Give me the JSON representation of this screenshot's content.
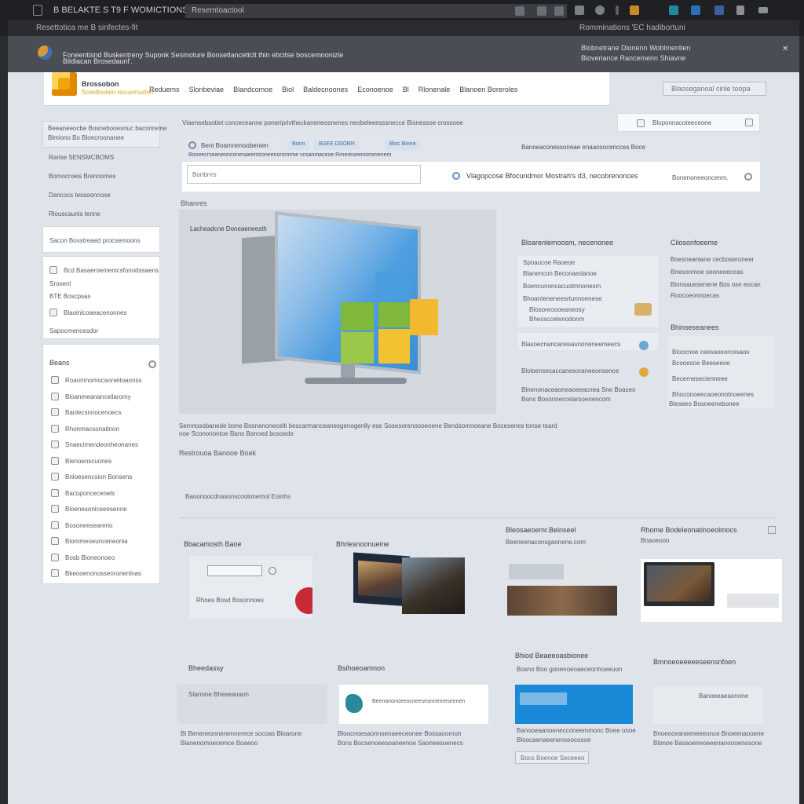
{
  "chrome": {
    "title": "B BELAKTE S T9  F WOMICTIONS",
    "url": "Resemtoactool",
    "subbar_left": "Resettotica me  B sinfectes-fit",
    "subbar_right": "Romminations 'EC hadibortuni"
  },
  "banner": {
    "line1": "Foneentisnd Buskentreny Suponk Sesmoture Bonsetlanceticlt thin ebcitse boscemnonizle",
    "line2": "Bildlacan Brosedaunl'.",
    "right1": "Blobnetrane Dionenn Woblmentien",
    "right2": "Bloveriance Rancemenn Shiavne"
  },
  "navbar": {
    "brand": "Brossobon",
    "brand_sub": "Sciedbiolien recuemusten",
    "links": [
      "Reduems",
      "Slonbeviae",
      "Blandcomoe",
      "Biol",
      "Baldecnoones",
      "Econoenoe",
      "Bl",
      "Rlonenale",
      "Blanoen Boreroles"
    ],
    "header_button": "Blaoseganoal   cinle toopa"
  },
  "sidebar": {
    "top_line1": "Beeaneeocbe Bosnebooesnuc baconreme",
    "top_line2": "Blmiono    Bo Bloecroonanee",
    "plain": [
      "Rarise    SENSMCBOMS",
      "Bomocroeis Brennomes",
      "Dancocs tesseonnose",
      "Rlouscaunis tenne"
    ],
    "box1": "Sacon   Bosstreaed  procsemoons",
    "box2": [
      "Bcd Basaeroemenicsfonodssaens",
      "Srosenl",
      "BTE  Boscpsas",
      "Blaoinlcoaeacenonnes"
    ],
    "box2_extra": "Sapocmencesdor",
    "box3_title": "Beans",
    "box3_items": [
      "Roaonmomocaoneitoaonss",
      "Bloanmeananceilaromy",
      "Banlecsnnocenoecs",
      "Rhonmacsonatinon",
      "Snaecimendeonheonanes",
      "Blenoenscuones",
      "Bnloesencsion Bonsens",
      "Bacoponcecenels",
      "Bloenesoniceeesenne",
      "Bosoneeseareno",
      "Blommeoeunceneonia",
      "Bosb  Bioneonoeo",
      "Bkeooenonossenronenlnas"
    ]
  },
  "search": {
    "breadcrumb": "Viaensebsotiet conceceanne poneriprivtheckaneneosnenes neobeleensssnecce Bisnessoe crossoee",
    "top_placeholder": "Bloponnacoteeceone",
    "toolbar_left": "Bent Boamnenoobenien",
    "toolbar_sub": "Boneecrseaneonconenaeentconeenorsrmme vcsanmaceoe Rrnereseencenmenem",
    "badge1": "Bonn",
    "badge2": "BSEE DSORR",
    "badge3": "Bloc Binne",
    "toolbar_right": "Banoeaconessoneae enaaosocencces  Boce",
    "input_placeholder": "Bonbrrrs",
    "message": "Vlagopcose Bfocundmor Mostrah's d3, necobrenonces",
    "message_right": "Bonenoneeoncenm."
  },
  "main": {
    "section": "Bhanres",
    "hero_caption": "Lacheadcne Doneaeneesth",
    "desc1": "Semnosobanede bone Bosnenonecelti bescarmanceanesgenogenlly ese Sosesorenoooeoene Bendsomnoeane Bocesenes tonse teard",
    "desc2": "ooe Scononontoe Bans Banoed bosoede",
    "desc3": "Restrouoa Banooe Boek",
    "info1_title": "Bloarenlemoosm, necenonee",
    "info1_lines": [
      "Spoaucoe  Raoeoe",
      "Blanencon  Beconaedanoe",
      "Boencunoncacuotmnonesm",
      "Bhoanteneneesrtunnoeoese",
      "Blosoreoooeaneosy",
      "Bhessccetenodonm"
    ],
    "info1_more": [
      "Blasoecnancanesasnoneneemeecs",
      "Bloloensecaccanesoraneeonsence",
      "Blnenonaceaoneaoeeacnea Sne Boaseo",
      "Bons  Bosonnercetarsoenencom"
    ],
    "info2_title": "Cilosonfoeeme",
    "info2_lines": [
      "Boesneaniane  cecboseroneer",
      "Bnesonmoe seoneoeceas",
      "Bionsauesenene Bos ose eocan",
      "Roocoeonnoecas"
    ],
    "info2_sub": "Bhinseseanees",
    "info2_more": [
      "Bloocnoe ceesaoeorcesaos",
      "Bcooesoe Beeseeoe",
      "Becernesecienneee",
      "Bhoconoeecaoeonotnoeenes",
      "Bleseeo Bosneenebonee"
    ],
    "section2": "Baoonoocdnasonscoolonemol Eoinhs"
  },
  "cards": [
    {
      "title": "Bbacamosth Baoe",
      "text": "Rhoes Bosd Bosonnoes"
    },
    {
      "title": "Bhrlesnoonueine",
      "text": ""
    },
    {
      "title": "Bleosaeoemr.Beinseel",
      "text": "Beeneenaconsgaonene.com"
    },
    {
      "title": "Rhome Bodeleonatinoeolmocs",
      "text": "Bnaoeoon"
    }
  ],
  "cards2": [
    {
      "title": "Bheedassy",
      "box": "Stanone Bheseanaon",
      "text1": "Bl   Beneneonnenennerece socoas Bloarone",
      "text2": "Blanenomnecemce Boaeoo"
    },
    {
      "title": "Bsihoeoamnon",
      "box": "Beenanonoeeocneeseonnemeseenen",
      "text1": "Bloocnoesaonnoenaeeceonee Bossaoornon",
      "text2": "Bons Bocsenoeesoaneenoe Saoneesoenecs"
    },
    {
      "title": "Bhiod Beaeeoasbionee",
      "box": "",
      "text1": "Banooeaanoenecconeemmonc Boee onoe",
      "text2": "Bloocaenaeenenseocosoe",
      "sub": "Bosno Boo gonenoeoaeceonhoeeuon"
    },
    {
      "title": "Bmnoeoeeeeeseensnfoen",
      "box": "Banoeeaeaonone",
      "text1": "Bnoeoceaneeneeeonce Bnoeenaooene",
      "text2": "Blonoe Basaoeneoeeenanoooenosone"
    }
  ],
  "more_button": "Bocs Boenoe Seceeeo",
  "colors": {
    "accent_yellow": "#f2a40a",
    "accent_blue": "#3a8fd8",
    "tile_green": "#7fb83a",
    "tile_yellow": "#f2c230"
  }
}
